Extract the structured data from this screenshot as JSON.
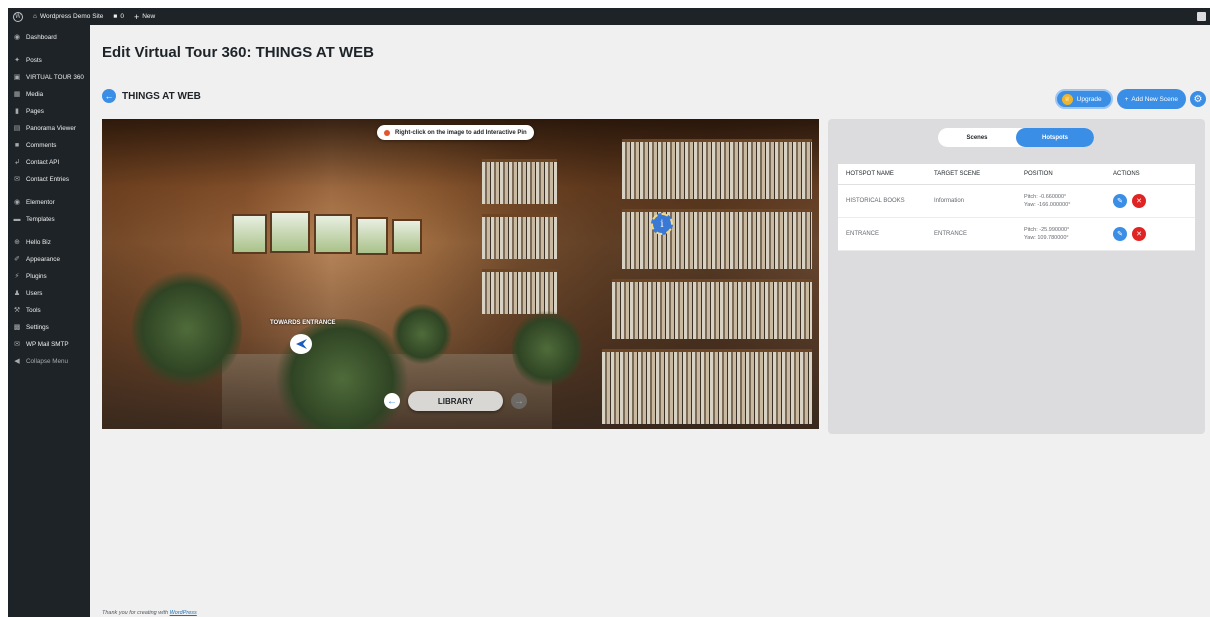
{
  "adminbar": {
    "site_name": "Wordpress Demo Site",
    "comments_count": "0",
    "new_label": "New"
  },
  "sidebar": {
    "items": [
      {
        "label": "Dashboard",
        "icon": "dashboard-icon"
      },
      {
        "label": "Posts",
        "icon": "pin-icon"
      },
      {
        "label": "VIRTUAL TOUR 360",
        "icon": "film-icon"
      },
      {
        "label": "Media",
        "icon": "media-icon"
      },
      {
        "label": "Pages",
        "icon": "page-icon"
      },
      {
        "label": "Panorama Viewer",
        "icon": "panorama-icon"
      },
      {
        "label": "Comments",
        "icon": "comment-icon"
      },
      {
        "label": "Contact API",
        "icon": "api-icon"
      },
      {
        "label": "Contact Entries",
        "icon": "mail-icon"
      },
      {
        "label": "Elementor",
        "icon": "elementor-icon"
      },
      {
        "label": "Templates",
        "icon": "folder-icon"
      },
      {
        "label": "Hello Biz",
        "icon": "plus-circle-icon"
      },
      {
        "label": "Appearance",
        "icon": "brush-icon"
      },
      {
        "label": "Plugins",
        "icon": "plug-icon"
      },
      {
        "label": "Users",
        "icon": "user-icon"
      },
      {
        "label": "Tools",
        "icon": "wrench-icon"
      },
      {
        "label": "Settings",
        "icon": "settings-icon"
      },
      {
        "label": "WP Mail SMTP",
        "icon": "mail-smtp-icon"
      },
      {
        "label": "Collapse Menu",
        "icon": "collapse-icon"
      }
    ]
  },
  "page": {
    "title": "Edit Virtual Tour 360: THINGS AT WEB",
    "scene_title": "THINGS AT WEB",
    "upgrade_label": "Upgrade",
    "add_scene_label": "Add New Scene"
  },
  "panorama": {
    "hint": "Right-click on the image to add Interactive Pin",
    "hotspot_label": "TOWARDS ENTRANCE",
    "current_scene": "LIBRARY"
  },
  "panel": {
    "tabs": [
      {
        "label": "Scenes",
        "active": false
      },
      {
        "label": "Hotspots",
        "active": true
      }
    ],
    "columns": [
      "HOTSPOT NAME",
      "TARGET SCENE",
      "POSITION",
      "ACTIONS"
    ],
    "rows": [
      {
        "name": "HISTORICAL BOOKS",
        "target": "Information",
        "pitch": "Pitch: -0.660000°",
        "yaw": "Yaw: -166.000000°"
      },
      {
        "name": "ENTRANCE",
        "target": "ENTRANCE",
        "pitch": "Pitch: -25.990000°",
        "yaw": "Yaw: 109.780000°"
      }
    ]
  },
  "footer": {
    "text": "Thank you for creating with",
    "link": "WordPress"
  },
  "colors": {
    "accent": "#3a8ee6",
    "danger": "#e02424",
    "sidebar": "#1d2327"
  }
}
